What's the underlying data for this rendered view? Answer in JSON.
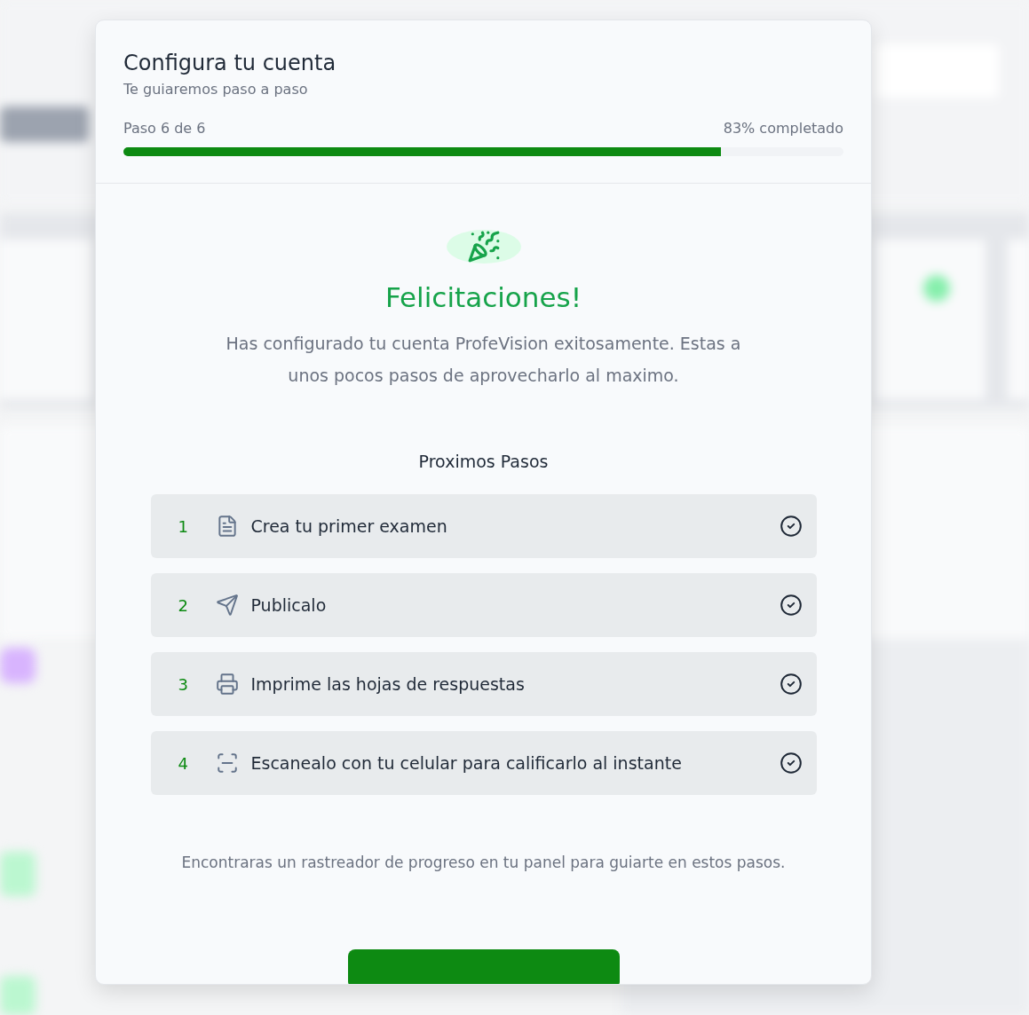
{
  "dialog": {
    "title": "Configura tu cuenta",
    "subtitle": "Te guiaremos paso a paso",
    "step_label": "Paso 6 de 6",
    "percent_label": "83% completado",
    "progress": {
      "level": 0.83
    }
  },
  "success": {
    "heading": "Felicitaciones!",
    "message": "Has configurado tu cuenta ProfeVision exitosamente. Estas a unos pocos pasos de aprovecharlo al maximo."
  },
  "next_steps": {
    "title": "Proximos Pasos",
    "items": [
      {
        "number": "1",
        "kind": "document",
        "label": "Crea tu primer examen",
        "done": true
      },
      {
        "number": "2",
        "kind": "send",
        "label": "Publicalo",
        "done": true
      },
      {
        "number": "3",
        "kind": "printer",
        "label": "Imprime las hojas de respuestas",
        "done": true
      },
      {
        "number": "4",
        "kind": "scan",
        "label": "Escanealo con tu celular para calificarlo al instante",
        "done": true
      }
    ]
  },
  "footer_note": "Encontraras un rastreador de progreso en tu panel para guiarte en estos pasos."
}
